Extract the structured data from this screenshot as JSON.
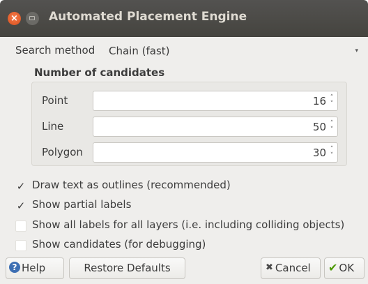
{
  "window": {
    "title": "Automated Placement Engine",
    "close_glyph": "×"
  },
  "search": {
    "label": "Search method",
    "value": "Chain (fast)"
  },
  "candidates": {
    "title": "Number of candidates",
    "point": {
      "label": "Point",
      "value": "16"
    },
    "line": {
      "label": "Line",
      "value": "50"
    },
    "polygon": {
      "label": "Polygon",
      "value": "30"
    }
  },
  "options": [
    {
      "label": "Draw text as outlines (recommended)",
      "checked": true
    },
    {
      "label": "Show partial labels",
      "checked": true
    },
    {
      "label": "Show all labels for all layers (i.e. including colliding objects)",
      "checked": false
    },
    {
      "label": "Show candidates (for debugging)",
      "checked": false
    }
  ],
  "check_glyph": "✓",
  "buttons": {
    "help": {
      "label": "Help",
      "icon": "help-icon",
      "icon_glyph": "?"
    },
    "restore": {
      "label": "Restore Defaults"
    },
    "cancel": {
      "label": "Cancel",
      "icon": "cancel-icon",
      "icon_glyph": "✖"
    },
    "ok": {
      "label": "OK",
      "icon": "checkmark-icon",
      "icon_glyph": "✔"
    }
  },
  "colors": {
    "titlebar": "#4a4947",
    "close_button": "#e9602f",
    "dialog_bg": "#efeeec",
    "help_icon": "#3d6fb3",
    "ok_icon": "#4e9a06"
  }
}
